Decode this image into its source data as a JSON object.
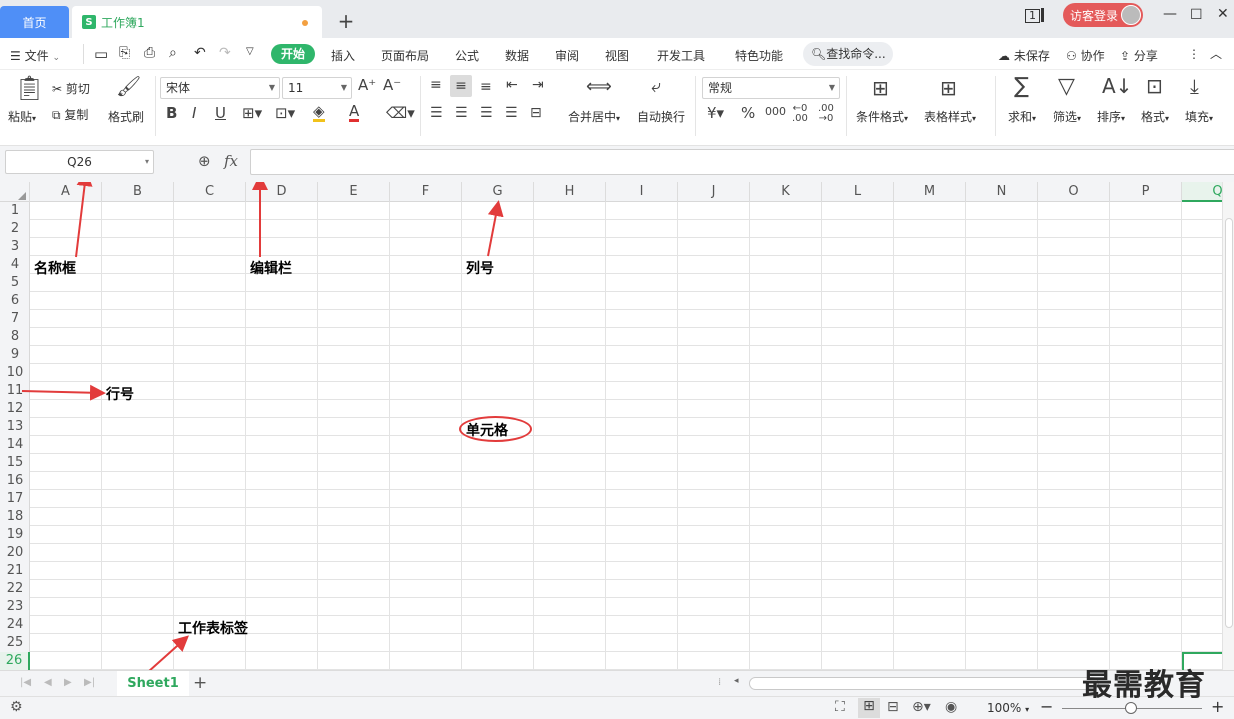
{
  "titlebar": {
    "home_tab": "首页",
    "book_tab": "工作簿1",
    "window_counter": "1",
    "guest_login": "访客登录"
  },
  "menus": {
    "file": "文件",
    "start": "开始",
    "insert": "插入",
    "page_layout": "页面布局",
    "formulas": "公式",
    "data": "数据",
    "review": "审阅",
    "view": "视图",
    "developer": "开发工具",
    "special": "特色功能",
    "search_cmd": "查找命令...",
    "unsaved": "未保存",
    "collab": "协作",
    "share": "分享"
  },
  "ribbon": {
    "paste": "粘贴",
    "cut": "剪切",
    "copy": "复制",
    "format_painter": "格式刷",
    "font_name": "宋体",
    "font_size": "11",
    "merge_center": "合并居中",
    "wrap_text": "自动换行",
    "number_format": "常规",
    "cond_format": "条件格式",
    "table_style": "表格样式",
    "sum": "求和",
    "filter": "筛选",
    "sort": "排序",
    "format": "格式",
    "fill": "填充"
  },
  "formula_bar": {
    "name_box": "Q26",
    "fx": "fx"
  },
  "grid": {
    "columns": [
      "A",
      "B",
      "C",
      "D",
      "E",
      "F",
      "G",
      "H",
      "I",
      "J",
      "K",
      "L",
      "M",
      "N",
      "O",
      "P",
      "Q"
    ],
    "rows": [
      "1",
      "2",
      "3",
      "4",
      "5",
      "6",
      "7",
      "8",
      "9",
      "10",
      "11",
      "12",
      "13",
      "14",
      "15",
      "16",
      "17",
      "18",
      "19",
      "20",
      "21",
      "22",
      "23",
      "24",
      "25",
      "26"
    ]
  },
  "annotations": {
    "name_box": "名称框",
    "edit_bar": "编辑栏",
    "column_number": "列号",
    "row_number": "行号",
    "cell": "单元格",
    "sheet_tab": "工作表标签"
  },
  "sheets": {
    "active": "Sheet1"
  },
  "status": {
    "zoom": "100%"
  },
  "watermark": "最需教育",
  "colors": {
    "accent_green": "#2fb66b",
    "home_blue": "#4f8ff7",
    "annotation_red": "#e23b3b"
  }
}
